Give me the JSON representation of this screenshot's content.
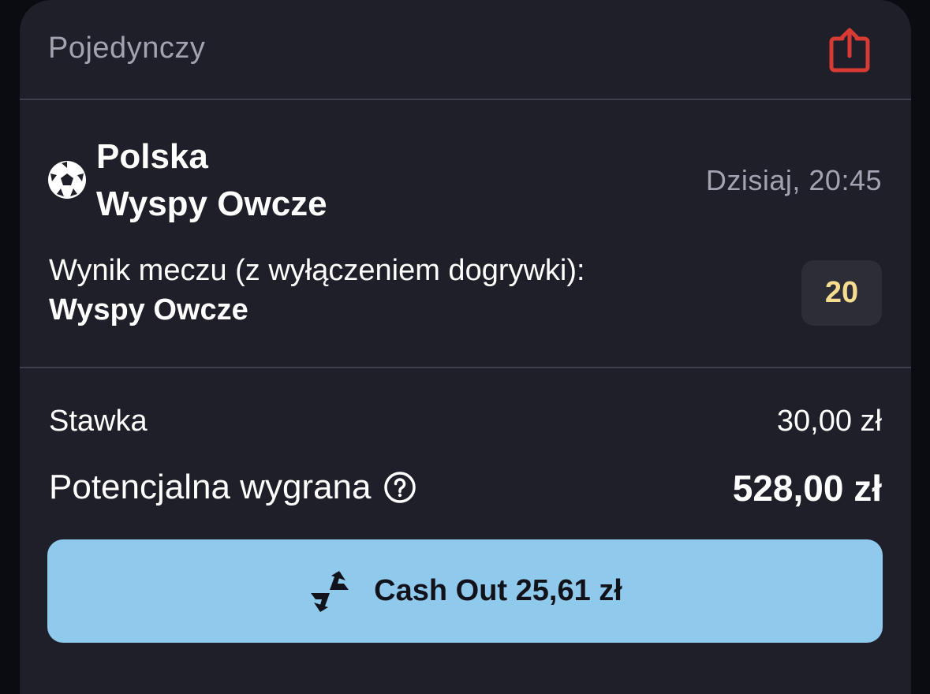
{
  "bet": {
    "type": "Pojedynczy",
    "share_icon": "share-icon",
    "accent_color": "#d83a34"
  },
  "event": {
    "sport_icon": "soccer-ball-icon",
    "home_team": "Polska",
    "away_team": "Wyspy Owcze",
    "time": "Dzisiaj, 20:45"
  },
  "selection": {
    "market": "Wynik meczu (z wyłączeniem dogrywki):",
    "pick": "Wyspy Owcze",
    "odds": "20",
    "odds_color": "#f5dc8e"
  },
  "summary": {
    "stake_label": "Stawka",
    "stake_value": "30,00 zł",
    "potential_win_label": "Potencjalna wygrana",
    "potential_win_value": "528,00 zł",
    "help_icon": "question-circle-icon"
  },
  "cashout": {
    "label": "Cash Out 25,61 zł",
    "icon": "cashout-arrows-icon",
    "color": "#8fc9ec"
  }
}
